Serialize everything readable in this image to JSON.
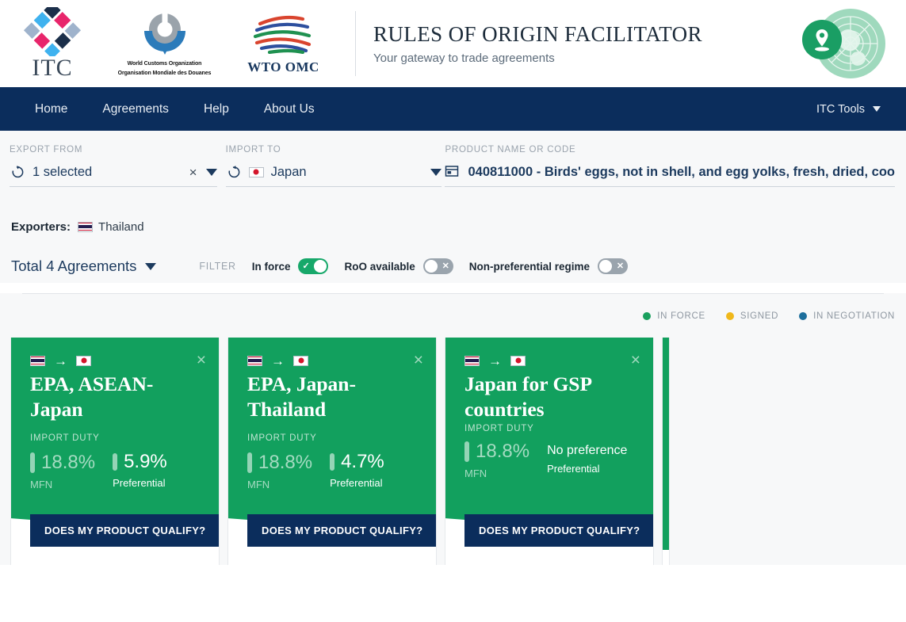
{
  "header": {
    "logos": {
      "itc": "ITC",
      "wco_line1": "World Customs Organization",
      "wco_line2": "Organisation Mondiale des Douanes",
      "wto": "WTO  OMC"
    },
    "title": "RULES OF ORIGIN FACILITATOR",
    "subtitle": "Your gateway to trade agreements"
  },
  "nav": {
    "links": [
      {
        "label": "Home"
      },
      {
        "label": "Agreements"
      },
      {
        "label": "Help"
      },
      {
        "label": "About Us"
      }
    ],
    "right_label": "ITC Tools"
  },
  "search": {
    "export_from": {
      "label": "EXPORT FROM",
      "value": "1 selected",
      "clear": "×"
    },
    "import_to": {
      "label": "IMPORT TO",
      "value": "Japan",
      "flag": "flag-japan"
    },
    "product": {
      "label": "PRODUCT NAME OR CODE",
      "value": "040811000 - Birds' eggs, not in shell, and egg yolks, fresh, dried, coo"
    }
  },
  "exporters": {
    "label": "Exporters:",
    "items": [
      {
        "name": "Thailand",
        "flag": "flag-thailand"
      }
    ]
  },
  "filters": {
    "total_label": "Total 4 Agreements",
    "filter_word": "FILTER",
    "toggles": [
      {
        "label": "In force",
        "state": "on"
      },
      {
        "label": "RoO available",
        "state": "off"
      },
      {
        "label": "Non-preferential regime",
        "state": "off"
      }
    ]
  },
  "legend": [
    {
      "label": "IN FORCE",
      "color": "#1aa05e"
    },
    {
      "label": "SIGNED",
      "color": "#f0b81b"
    },
    {
      "label": "IN NEGOTIATION",
      "color": "#1c6e9c"
    }
  ],
  "cards": [
    {
      "from_flag": "flag-thailand",
      "to_flag": "flag-japan",
      "arrow": "→",
      "close": "×",
      "title": "EPA, ASEAN-Japan",
      "import_duty_label": "IMPORT DUTY",
      "mfn_value": "18.8%",
      "mfn_caption": "MFN",
      "pref_value": "5.9%",
      "pref_caption": "Preferential",
      "pref_is_text": false,
      "button": "DOES MY PRODUCT QUALIFY?",
      "status_color": "#12a05e"
    },
    {
      "from_flag": "flag-thailand",
      "to_flag": "flag-japan",
      "arrow": "→",
      "close": "×",
      "title": "EPA, Japan-Thailand",
      "import_duty_label": "IMPORT DUTY",
      "mfn_value": "18.8%",
      "mfn_caption": "MFN",
      "pref_value": "4.7%",
      "pref_caption": "Preferential",
      "pref_is_text": false,
      "button": "DOES MY PRODUCT QUALIFY?",
      "status_color": "#12a05e"
    },
    {
      "from_flag": "flag-thailand",
      "to_flag": "flag-japan",
      "arrow": "→",
      "close": "×",
      "title": "Japan for GSP countries",
      "import_duty_label": "IMPORT DUTY",
      "mfn_value": "18.8%",
      "mfn_caption": "MFN",
      "pref_value": "No preference",
      "pref_caption": "Preferential",
      "pref_is_text": true,
      "button": "DOES MY PRODUCT QUALIFY?",
      "status_color": "#12a05e"
    },
    {
      "partial": true,
      "status_color": "#12a05e"
    }
  ],
  "colors": {
    "nav_bg": "#0b2d5c",
    "card_green": "#12a05e",
    "page_bg": "#f7f8f9",
    "accent_blue": "#1c3a5e"
  }
}
